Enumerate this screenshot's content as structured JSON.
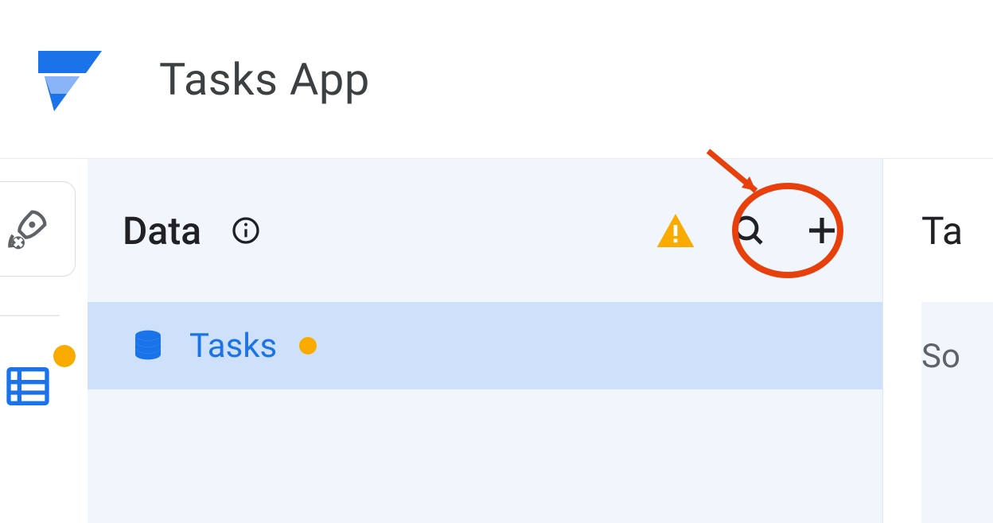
{
  "header": {
    "app_title": "Tasks App"
  },
  "data_panel": {
    "title": "Data",
    "tables": [
      {
        "name": "Tasks",
        "has_warning": true
      }
    ]
  },
  "right": {
    "tab_label_fragment": "Ta",
    "body_fragment": "So"
  },
  "icons": {
    "logo": "appsheet-logo",
    "info": "info-icon",
    "warning": "warning-icon",
    "search": "search-icon",
    "plus": "plus-icon",
    "rocket": "rocket-icon",
    "data": "data-icon",
    "database": "database-icon"
  },
  "colors": {
    "accent_blue": "#1a73e8",
    "warn_orange": "#f9ab00",
    "panel_bg": "#f1f6fd",
    "row_selected": "#cfe0fb",
    "annotation": "#e8400c"
  }
}
